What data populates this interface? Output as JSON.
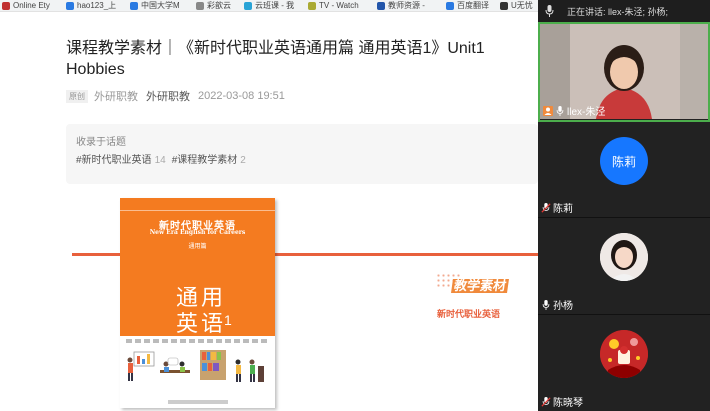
{
  "bookmarks": [
    {
      "label": "Online Ety",
      "color": "#c03030"
    },
    {
      "label": "hao123_上",
      "color": "#2a7ae2"
    },
    {
      "label": "中国大学M",
      "color": "#2a7ae2"
    },
    {
      "label": "彩歆云",
      "color": "#888888"
    },
    {
      "label": "云班课 - 我",
      "color": "#29a3d6"
    },
    {
      "label": "TV - Watch",
      "color": "#aaaa33"
    },
    {
      "label": "教师资源 -",
      "color": "#2255aa"
    },
    {
      "label": "百度翻译",
      "color": "#2a7ae2"
    },
    {
      "label": "U无忧",
      "color": "#333333"
    }
  ],
  "article": {
    "title": "课程教学素材｜《新时代职业英语通用篇 通用英语1》Unit1 Hobbies",
    "original_tag": "原创",
    "author_gray": "外研职教",
    "author": "外研职教",
    "date": "2022-03-08 19:51",
    "topic_label": "收录于话题",
    "topics": [
      {
        "name": "#新时代职业英语",
        "count": "14"
      },
      {
        "name": "#课程教学素材",
        "count": "2"
      }
    ]
  },
  "banner": {
    "material_label": "教学素材",
    "series_label": "新时代职业英语",
    "accent": "#e8603c"
  },
  "book": {
    "series_cn": "新时代职业英语",
    "series_en": "New Era English for Careers",
    "edition": "通用篇",
    "title_line1": "通用",
    "title_line2": "英语",
    "volume": "1",
    "cover_color": "#f47b20"
  },
  "meeting": {
    "speaking_text": "正在讲话: llex-朱泾; 孙杨;",
    "participants": [
      {
        "name": "llex-朱泾",
        "type": "video",
        "active": true
      },
      {
        "name": "陈莉",
        "type": "initials",
        "initials": "陈莉",
        "color": "#1677ff"
      },
      {
        "name": "孙杨",
        "type": "photo"
      },
      {
        "name": "陈晓琴",
        "type": "photo"
      }
    ]
  }
}
